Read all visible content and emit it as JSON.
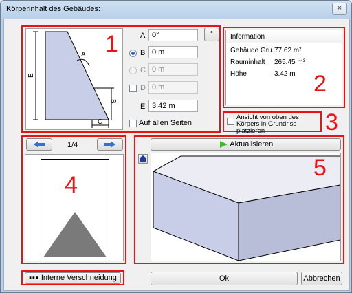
{
  "window": {
    "title": "Körperinhalt des Gebäudes:",
    "close_glyph": "×"
  },
  "params": {
    "A": {
      "label": "A",
      "value": "0°"
    },
    "B": {
      "label": "B",
      "value": "0 m"
    },
    "C": {
      "label": "C",
      "value": "0 m"
    },
    "D": {
      "label": "D",
      "value": "0 m"
    },
    "E": {
      "label": "E",
      "value": "3.42 m"
    },
    "degree_button": "°",
    "all_sides": "Auf allen Seiten"
  },
  "sketch": {
    "label_A": "A",
    "label_B": "B",
    "label_C": "C",
    "label_E": "E"
  },
  "info": {
    "header": "Information",
    "rows": [
      {
        "name": "Gebäude Gru...",
        "value": "77.62 m²"
      },
      {
        "name": "Rauminhalt",
        "value": "265.45 m³"
      },
      {
        "name": "Höhe",
        "value": "3.42 m"
      }
    ]
  },
  "placement": {
    "label": "Ansicht von oben des Körpers in Grundriss platzieren"
  },
  "nav": {
    "page": "1/4"
  },
  "preview": {
    "refresh": "Aktualisieren"
  },
  "footer": {
    "intern": "Interne Verschneidung",
    "ok": "Ok",
    "cancel": "Abbrechen"
  },
  "annotations": {
    "n1": "1",
    "n2": "2",
    "n3": "3",
    "n4": "4",
    "n5": "5"
  },
  "colors": {
    "highlight": "#e11111",
    "shape_fill": "#c8cde8",
    "triangle": "#7a7a7a",
    "arrow": "#2f6fd6",
    "refresh_arrow": "#3dbf2a"
  }
}
